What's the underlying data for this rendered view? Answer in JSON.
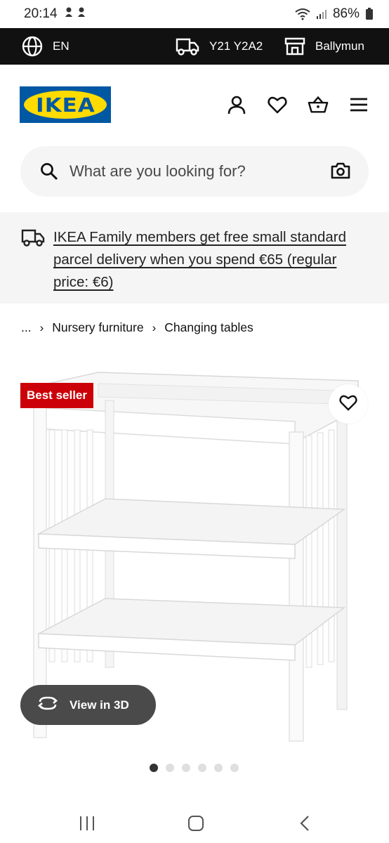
{
  "status_bar": {
    "time": "20:14",
    "battery": "86%"
  },
  "top_bar": {
    "language": "EN",
    "postcode": "Y21 Y2A2",
    "store": "Ballymun"
  },
  "header": {
    "logo_text": "IKEA",
    "brand_blue": "#0058a3",
    "brand_yellow": "#ffdb00"
  },
  "search": {
    "placeholder": "What are you looking for?"
  },
  "banner": {
    "text": "IKEA Family members get free small standard parcel delivery when you spend €65 (regular price: €6)"
  },
  "breadcrumb": {
    "ellipsis": "...",
    "items": [
      "Nursery furniture",
      "Changing tables"
    ]
  },
  "product": {
    "badge": "Best seller",
    "badge_color": "#cc0008",
    "view_3d_label": "View in 3D"
  },
  "carousel": {
    "total": 6,
    "active": 1
  }
}
